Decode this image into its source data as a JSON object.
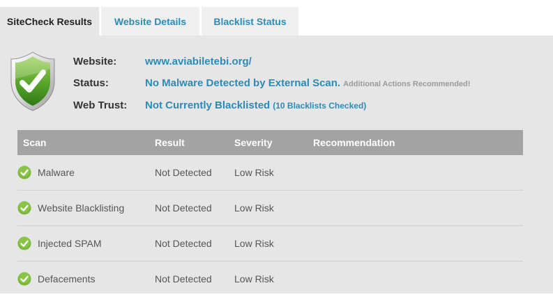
{
  "tabs": [
    {
      "label": "SiteCheck Results",
      "active": true
    },
    {
      "label": "Website Details",
      "active": false
    },
    {
      "label": "Blacklist Status",
      "active": false
    }
  ],
  "summary": {
    "shield_icon": "shield-check-icon",
    "website": {
      "label": "Website:",
      "value": "www.aviabiletebi.org/"
    },
    "status": {
      "label": "Status:",
      "value": "No Malware Detected by External Scan.",
      "note": "Additional Actions Recommended!"
    },
    "web_trust": {
      "label": "Web Trust:",
      "value": "Not Currently Blacklisted",
      "note": "(10 Blacklists Checked)"
    }
  },
  "table": {
    "headers": [
      "Scan",
      "Result",
      "Severity",
      "Recommendation"
    ],
    "rows": [
      {
        "scan": "Malware",
        "result": "Not Detected",
        "severity": "Low Risk",
        "recommendation": ""
      },
      {
        "scan": "Website Blacklisting",
        "result": "Not Detected",
        "severity": "Low Risk",
        "recommendation": ""
      },
      {
        "scan": "Injected SPAM",
        "result": "Not Detected",
        "severity": "Low Risk",
        "recommendation": ""
      },
      {
        "scan": "Defacements",
        "result": "Not Detected",
        "severity": "Low Risk",
        "recommendation": ""
      }
    ]
  },
  "colors": {
    "accent": "#2b8bb6",
    "panel_bg": "#e6e6e6",
    "header_bg": "#a3a3a3",
    "ok_green": "#7bb83a"
  }
}
